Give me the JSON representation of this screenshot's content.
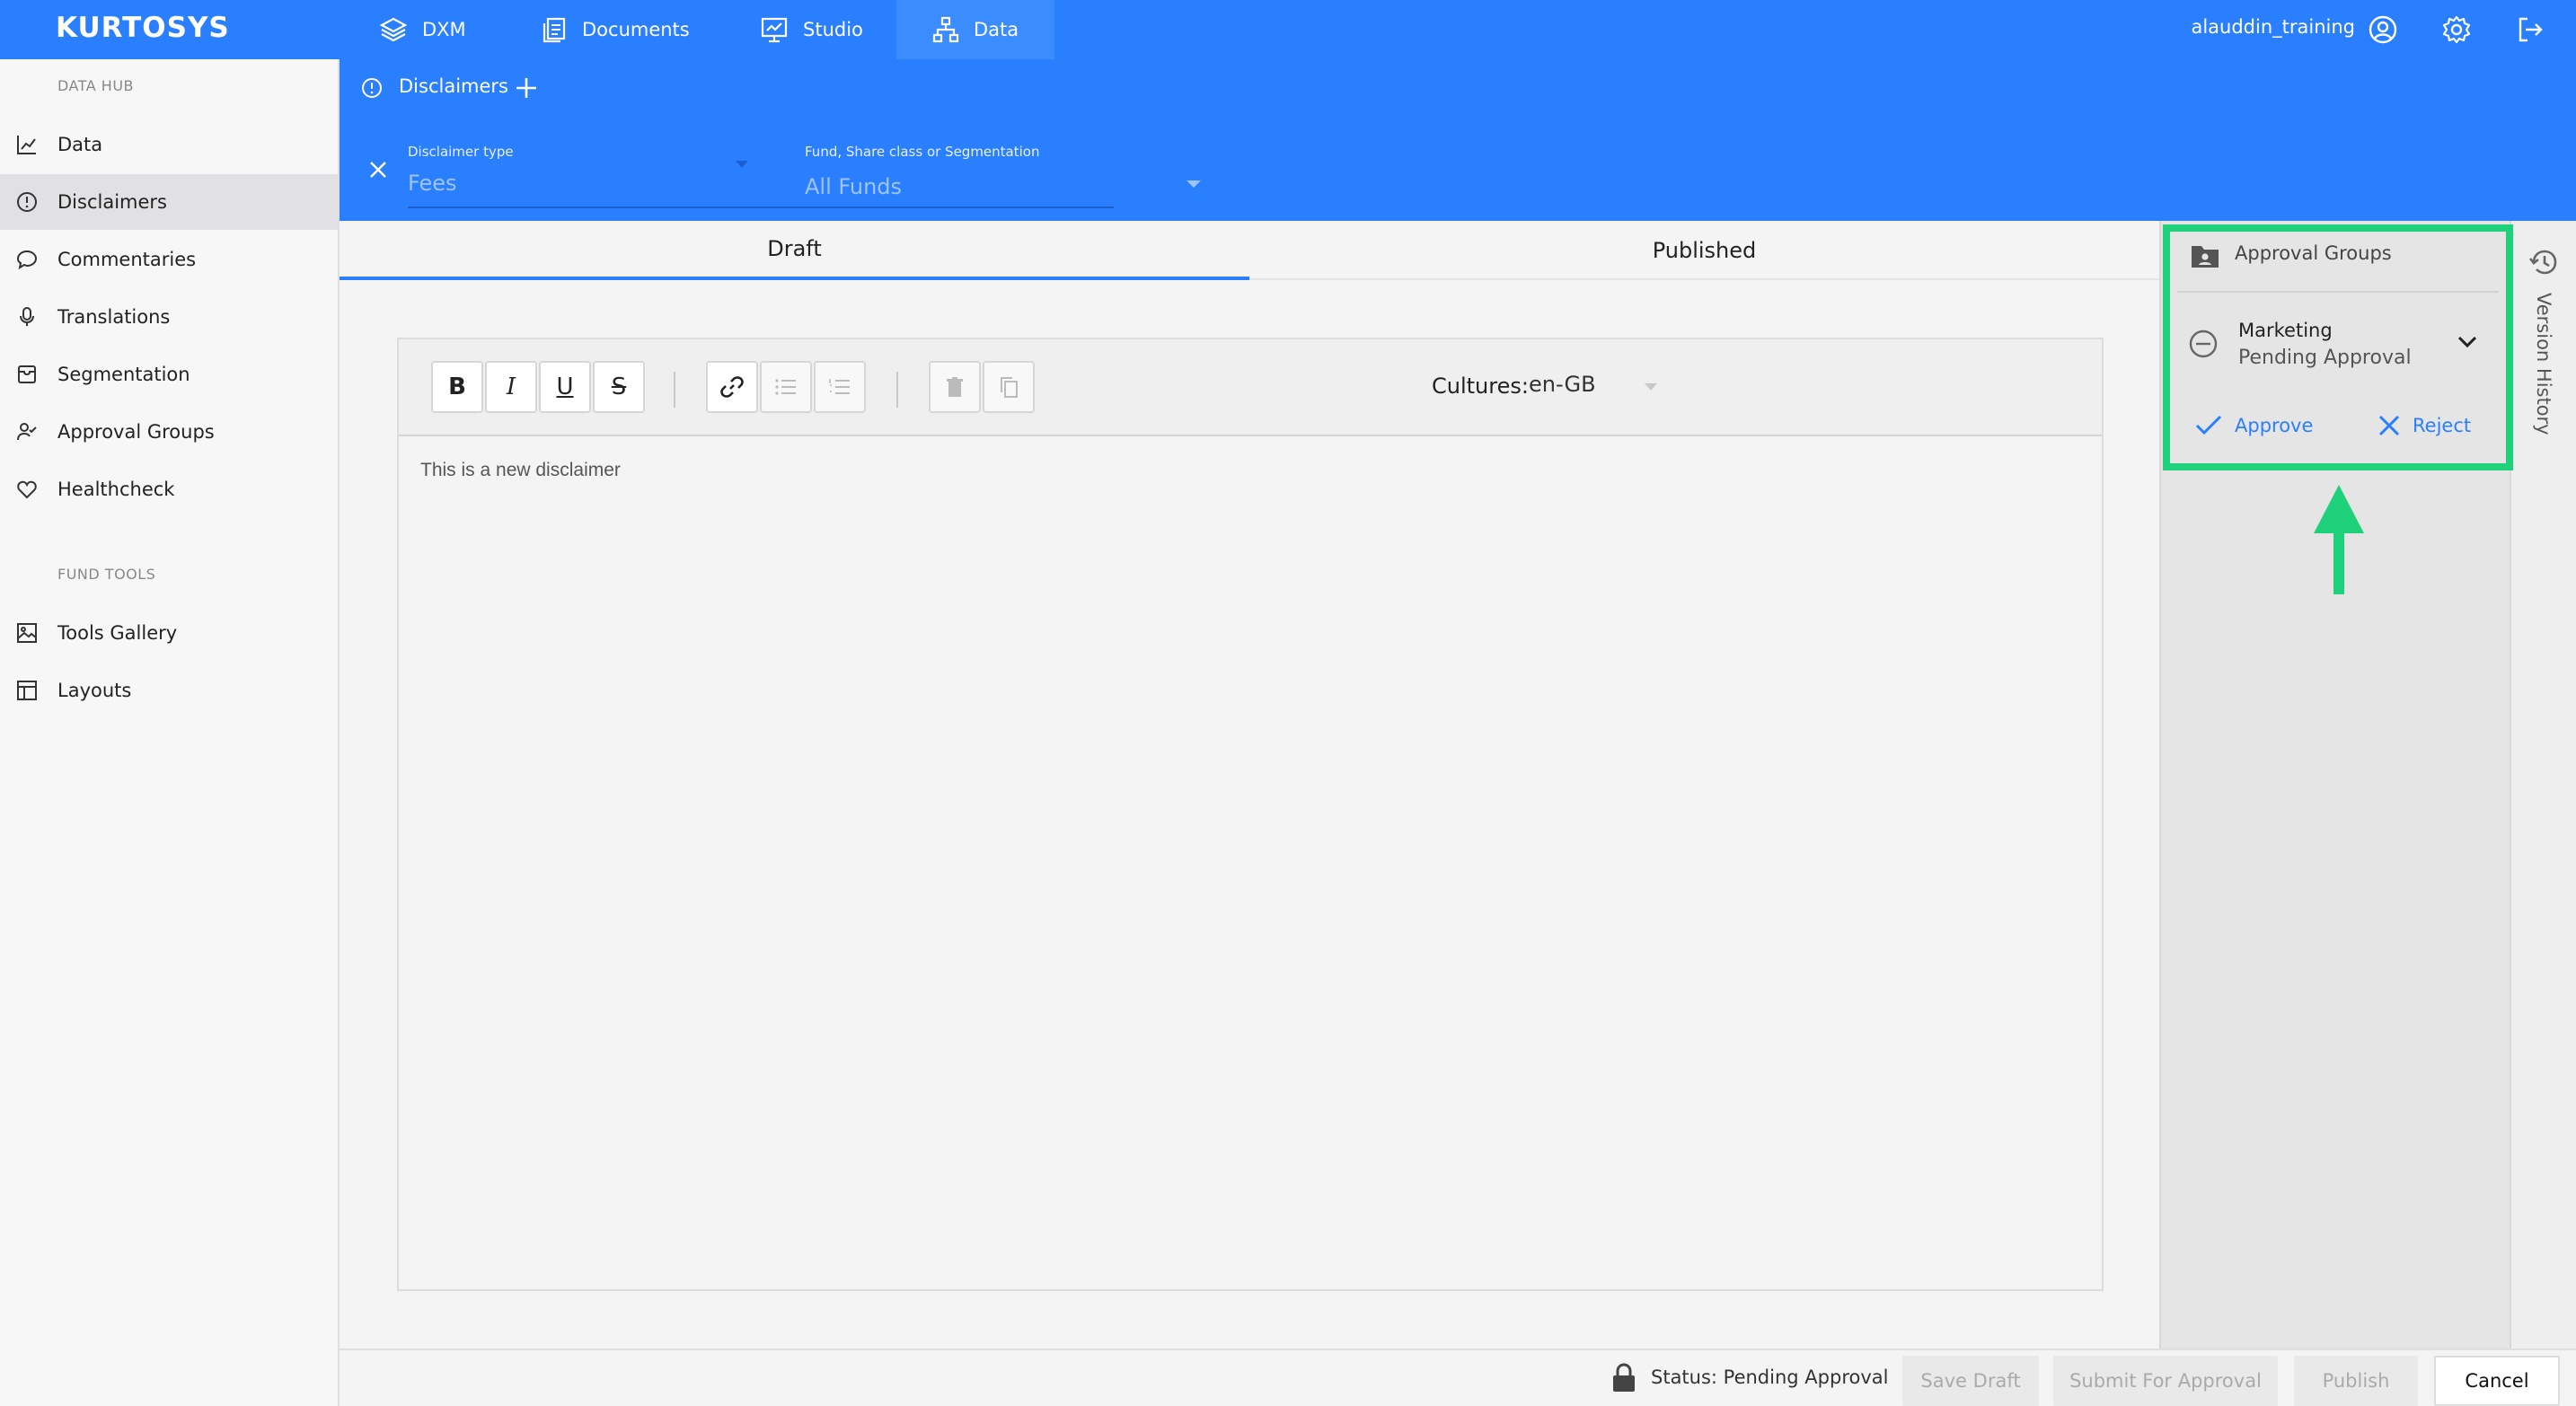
{
  "brand": {
    "logo": "KURTOSYS"
  },
  "topnav": {
    "tabs": [
      {
        "label": "DXM",
        "icon": "layers-icon"
      },
      {
        "label": "Documents",
        "icon": "documents-icon"
      },
      {
        "label": "Studio",
        "icon": "studio-icon"
      },
      {
        "label": "Data",
        "icon": "hierarchy-icon",
        "active": true
      }
    ],
    "username": "alauddin_training"
  },
  "sidebar": {
    "section1": "DATA HUB",
    "items": [
      {
        "label": "Data",
        "icon": "chart-icon"
      },
      {
        "label": "Disclaimers",
        "icon": "info-icon",
        "active": true
      },
      {
        "label": "Commentaries",
        "icon": "comment-icon"
      },
      {
        "label": "Translations",
        "icon": "microphone-icon"
      },
      {
        "label": "Segmentation",
        "icon": "tray-icon"
      },
      {
        "label": "Approval Groups",
        "icon": "user-check-icon"
      },
      {
        "label": "Healthcheck",
        "icon": "heart-icon"
      }
    ],
    "section2": "FUND TOOLS",
    "tools": [
      {
        "label": "Tools Gallery",
        "icon": "image-icon"
      },
      {
        "label": "Layouts",
        "icon": "layout-icon"
      }
    ]
  },
  "subbar": {
    "title": "Disclaimers",
    "filter1_label": "Disclaimer type",
    "filter1_value": "Fees",
    "filter2_label": "Fund, Share class or Segmentation",
    "filter2_value": "All Funds"
  },
  "tabs": {
    "draft": "Draft",
    "published": "Published"
  },
  "editor": {
    "toolbar": {
      "bold": "B",
      "italic": "I",
      "underline": "U",
      "strike": "S"
    },
    "cultures_label": "Cultures:",
    "cultures_value": "en-GB",
    "content": "This is a new disclaimer"
  },
  "approval": {
    "title": "Approval Groups",
    "group_name": "Marketing",
    "group_status": "Pending Approval",
    "approve": "Approve",
    "reject": "Reject",
    "highlight_color": "#1fd17a"
  },
  "version_history": "Version History",
  "bottom": {
    "status": "Status: Pending Approval",
    "save_draft": "Save Draft",
    "submit": "Submit For Approval",
    "publish": "Publish",
    "cancel": "Cancel"
  },
  "colors": {
    "brand": "#2a7fff",
    "accent_green": "#1fd17a"
  }
}
